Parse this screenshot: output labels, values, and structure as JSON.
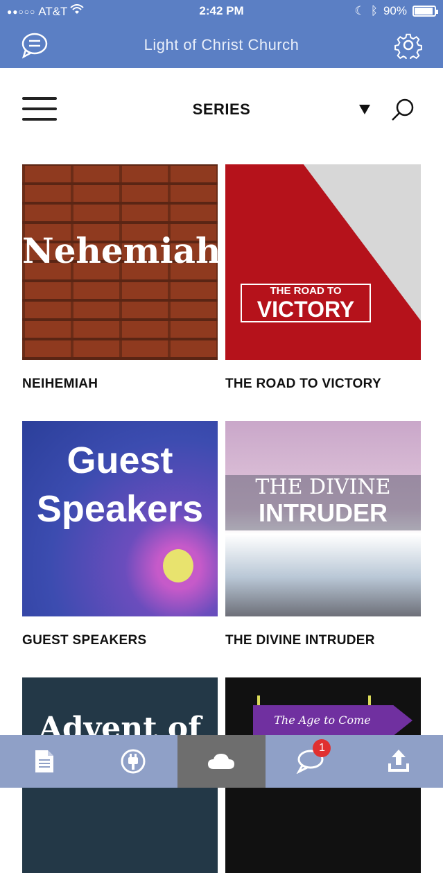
{
  "status_bar": {
    "carrier": "AT&T",
    "time": "2:42 PM",
    "battery": "90%"
  },
  "header": {
    "title": "Light of Christ Church"
  },
  "subheader": {
    "title": "SERIES"
  },
  "series": [
    {
      "thumb_text": "Nehemiah",
      "label": "NEIHEMIAH"
    },
    {
      "thumb_line1": "THE ROAD TO",
      "thumb_line2": "VICTORY",
      "label": "THE ROAD TO VICTORY"
    },
    {
      "thumb_line1": "Guest",
      "thumb_line2": "Speakers",
      "label": "GUEST SPEAKERS"
    },
    {
      "thumb_line1": "THE DIVINE",
      "thumb_line2": "INTRUDER",
      "label": "THE DIVINE INTRUDER"
    },
    {
      "thumb_text": "Advent of"
    },
    {
      "thumb_text": "The Age to Come"
    }
  ],
  "tabbar": {
    "items": [
      {
        "icon": "document-icon"
      },
      {
        "icon": "plug-icon"
      },
      {
        "icon": "cloud-icon",
        "active": true
      },
      {
        "icon": "chat-icon",
        "badge": "1"
      },
      {
        "icon": "upload-icon"
      }
    ]
  },
  "colors": {
    "header_bg": "#5b7fc4",
    "tabbar_bg": "#8fa0c7",
    "tab_active_bg": "#6e6e6e",
    "badge": "#e03030"
  }
}
